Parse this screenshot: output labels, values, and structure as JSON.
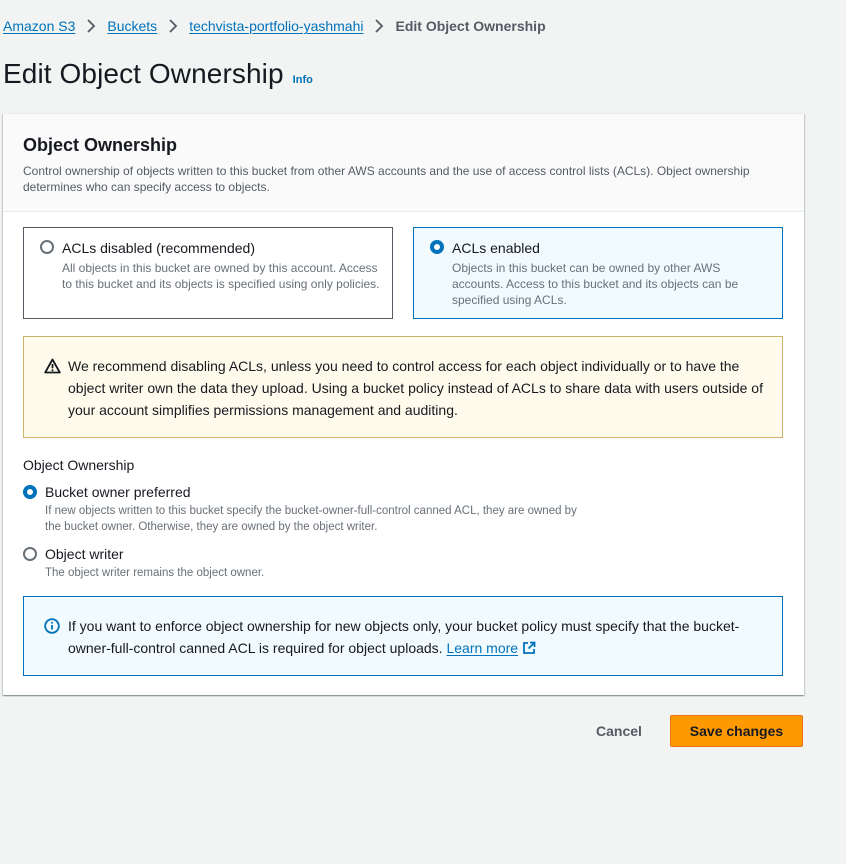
{
  "breadcrumb": {
    "items": [
      "Amazon S3",
      "Buckets",
      "techvista-portfolio-yashmahi"
    ],
    "current": "Edit Object Ownership"
  },
  "page": {
    "title": "Edit Object Ownership",
    "info_label": "Info"
  },
  "section": {
    "title": "Object Ownership",
    "description": "Control ownership of objects written to this bucket from other AWS accounts and the use of access control lists (ACLs). Object ownership determines who can specify access to objects."
  },
  "tiles": [
    {
      "title": "ACLs disabled (recommended)",
      "description": "All objects in this bucket are owned by this account. Access to this bucket and its objects is specified using only policies.",
      "selected": false
    },
    {
      "title": "ACLs enabled",
      "description": "Objects in this bucket can be owned by other AWS accounts. Access to this bucket and its objects can be specified using ACLs.",
      "selected": true
    }
  ],
  "warning": {
    "text": "We recommend disabling ACLs, unless you need to control access for each object individually or to have the object writer own the data they upload. Using a bucket policy instead of ACLs to share data with users outside of your account simplifies permissions management and auditing."
  },
  "ownership": {
    "label": "Object Ownership",
    "options": [
      {
        "label": "Bucket owner preferred",
        "description": "If new objects written to this bucket specify the bucket-owner-full-control canned ACL, they are owned by the bucket owner. Otherwise, they are owned by the object writer.",
        "selected": true
      },
      {
        "label": "Object writer",
        "description": "The object writer remains the object owner.",
        "selected": false
      }
    ]
  },
  "info_alert": {
    "text": "If you want to enforce object ownership for new objects only, your bucket policy must specify that the bucket-owner-full-control canned ACL is required for object uploads.",
    "link_label": "Learn more"
  },
  "actions": {
    "cancel_label": "Cancel",
    "save_label": "Save changes"
  },
  "colors": {
    "link": "#0073bb",
    "primary_button": "#ff9900",
    "selected_tile_bg": "#f1faff",
    "warning_bg": "#fffbec",
    "info_border": "#0073bb"
  },
  "icons": [
    "chevron-right-icon",
    "warning-icon",
    "info-circle-icon",
    "external-link-icon"
  ]
}
